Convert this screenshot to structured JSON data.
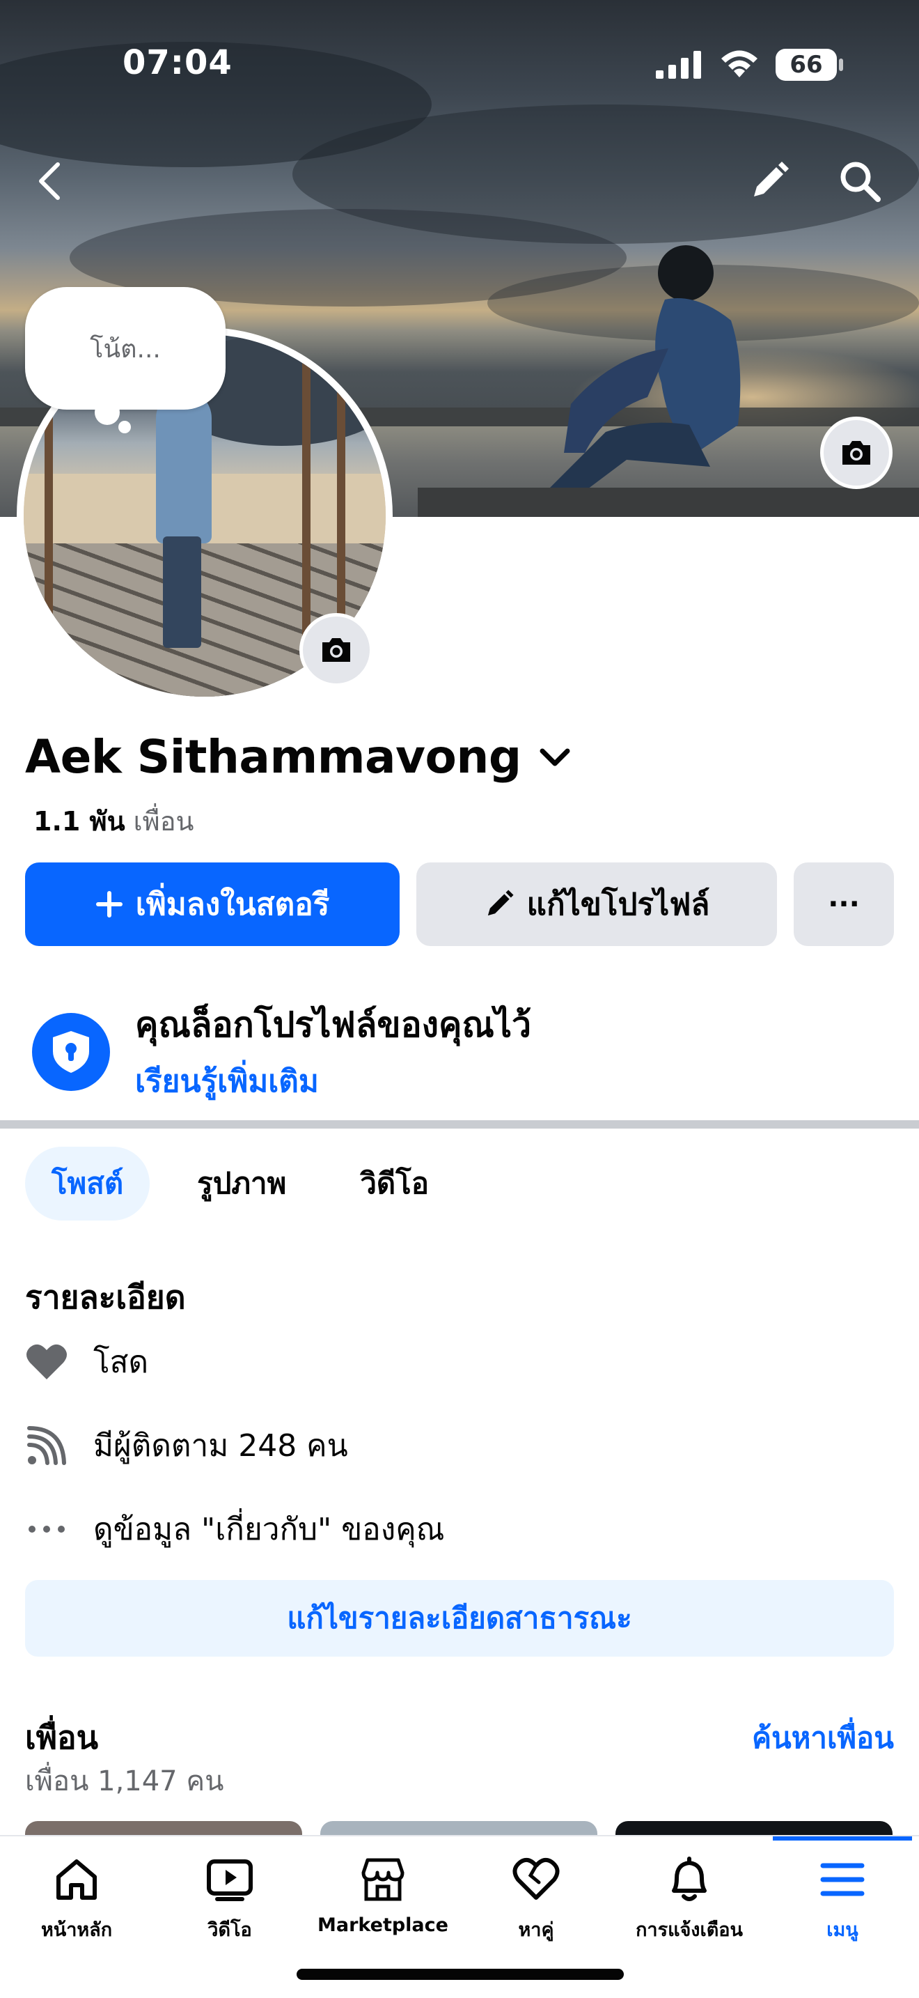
{
  "status_bar": {
    "time": "07:04",
    "battery": "66"
  },
  "note": {
    "placeholder": "โน้ต..."
  },
  "profile": {
    "name": "Aek Sithammavong",
    "friends_count": "1.1 พัน",
    "friends_label": "เพื่อน"
  },
  "actions": {
    "add_story": "เพิ่มลงในสตอรี",
    "edit_profile": "แก้ไขโปรไฟล์",
    "more": "···"
  },
  "lock_notice": {
    "title": "คุณล็อกโปรไฟล์ของคุณไว้",
    "link": "เรียนรู้เพิ่มเติม"
  },
  "tabs": [
    {
      "label": "โพสต์"
    },
    {
      "label": "รูปภาพ"
    },
    {
      "label": "วิดีโอ"
    }
  ],
  "details": {
    "title": "รายละเอียด",
    "relationship": "โสด",
    "followers": "มีผู้ติดตาม 248 คน",
    "about": "ดูข้อมูล \"เกี่ยวกับ\" ของคุณ",
    "edit_button": "แก้ไขรายละเอียดสาธารณะ"
  },
  "friends": {
    "title": "เพื่อน",
    "find_link": "ค้นหาเพื่อน",
    "count": "เพื่อน 1,147 คน"
  },
  "bottom_nav": [
    {
      "label": "หน้าหลัก",
      "icon": "home-icon"
    },
    {
      "label": "วิดีโอ",
      "icon": "video-icon"
    },
    {
      "label": "Marketplace",
      "icon": "marketplace-icon"
    },
    {
      "label": "หาคู่",
      "icon": "dating-icon"
    },
    {
      "label": "การแจ้งเตือน",
      "icon": "bell-icon"
    },
    {
      "label": "เมนู",
      "icon": "menu-icon"
    }
  ],
  "colors": {
    "accent": "#0866ff",
    "tab_active_bg": "#ebf5ff",
    "gray_button": "#e4e6eb",
    "secondary_text": "#65676b"
  }
}
